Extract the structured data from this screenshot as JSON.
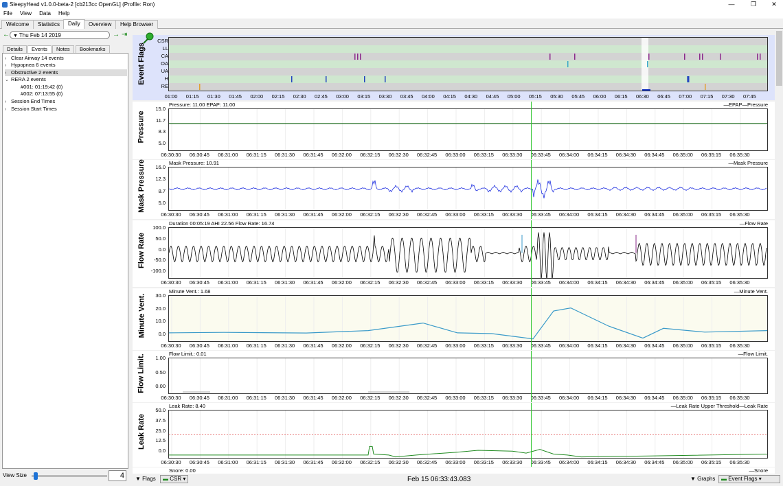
{
  "window": {
    "title": "SleepyHead v1.0.0-beta-2 [cb213cc OpenGL] (Profile: Ron)",
    "min": "—",
    "max": "❐",
    "close": "✕"
  },
  "menu": [
    "File",
    "View",
    "Data",
    "Help"
  ],
  "tabs": [
    "Welcome",
    "Statistics",
    "Daily",
    "Overview",
    "Help Browser"
  ],
  "active_tab": "Daily",
  "date": {
    "value": "Thu Feb 14 2019",
    "prev": "←",
    "next": "→",
    "last": "⇥"
  },
  "subtabs": [
    "Details",
    "Events",
    "Notes",
    "Bookmarks"
  ],
  "events": [
    {
      "arrow": "›",
      "label": "Clear Airway 14 events"
    },
    {
      "arrow": "›",
      "label": "Hypopnea 6 events"
    },
    {
      "arrow": "›",
      "label": "Obstructive 2 events"
    },
    {
      "arrow": "⌄",
      "label": "RERA 2 events"
    },
    {
      "arrow": "",
      "label": "#001: 01:19:42 (0)"
    },
    {
      "arrow": "",
      "label": "#002: 07:13:55 (0)"
    },
    {
      "arrow": "›",
      "label": "Session End Times"
    },
    {
      "arrow": "›",
      "label": "Session Start Times"
    }
  ],
  "view_size": {
    "label": "View Size",
    "value": "4"
  },
  "flags_chart": {
    "title": "Event Flags",
    "rows": [
      "CSR",
      "LL",
      "CA",
      "OA",
      "UA",
      "H",
      "RE"
    ],
    "x_ticks": [
      "01:00",
      "01:15",
      "01:30",
      "01:45",
      "02:00",
      "02:15",
      "02:30",
      "02:45",
      "03:00",
      "03:15",
      "03:30",
      "03:45",
      "04:00",
      "04:15",
      "04:30",
      "04:45",
      "05:00",
      "05:15",
      "05:30",
      "05:45",
      "06:00",
      "06:15",
      "06:30",
      "06:45",
      "07:00",
      "07:15",
      "07:30",
      "07:45"
    ]
  },
  "time_ticks": [
    "06:30:30",
    "06:30:45",
    "06:31:00",
    "06:31:15",
    "06:31:30",
    "06:31:45",
    "06:32:00",
    "06:32:15",
    "06:32:30",
    "06:32:45",
    "06:33:00",
    "06:33:15",
    "06:33:30",
    "06:33:45",
    "06:34:00",
    "06:34:15",
    "06:34:30",
    "06:34:45",
    "06:35:00",
    "06:35:15",
    "06:35:30"
  ],
  "graphs": [
    {
      "title": "Pressure",
      "info": "Pressure: 11.00 EPAP: 11.00",
      "legend": "—EPAP—Pressure",
      "yticks": [
        "15.0",
        "11.7",
        "8.3",
        "5.0"
      ]
    },
    {
      "title": "Mask Pressure",
      "info": "Mask Pressure: 10.91",
      "legend": "—Mask Pressure",
      "yticks": [
        "16.0",
        "12.3",
        "8.7",
        "5.0"
      ]
    },
    {
      "title": "Flow Rate",
      "info": "Duration 00:05:19 AHI 22.56 Flow Rate: 16.74",
      "legend": "—Flow Rate",
      "yticks": [
        "100.0",
        "50.0",
        "0.0",
        "-50.0",
        "-100.0"
      ],
      "markers": [
        "OA",
        "CA"
      ]
    },
    {
      "title": "Minute Vent.",
      "info": "Minute Vent.: 1.68",
      "legend": "—Minute Vent.",
      "yticks": [
        "30.0",
        "20.0",
        "10.0",
        "0.0"
      ]
    },
    {
      "title": "Flow Limit.",
      "info": "Flow Limit.: 0.01",
      "legend": "—Flow Limit.",
      "yticks": [
        "1.00",
        "0.50",
        "0.00"
      ]
    },
    {
      "title": "Leak Rate",
      "info": "Leak Rate: 8.40",
      "legend": "—Leak Rate Upper Threshold—Leak Rate",
      "yticks": [
        "50.0",
        "37.5",
        "25.0",
        "12.5",
        "0.0"
      ]
    }
  ],
  "snore": {
    "info": "Snore: 0.00",
    "legend": "—Snore"
  },
  "bottom": {
    "flags_label": "Flags",
    "flags_select": "CSR",
    "timestamp": "Feb 15 06:33:43.083",
    "graphs_label": "Graphs",
    "graphs_select": "Event Flags"
  },
  "colors": {
    "flags_green": "#cfe7cf",
    "cursor": "#2ec52e",
    "pressure": "#1c6b1c",
    "mask": "#1e2fe0",
    "flow": "#000000",
    "minvent": "#3a9ac9",
    "leak": "#1f8a1f",
    "threshold": "#e05050"
  }
}
